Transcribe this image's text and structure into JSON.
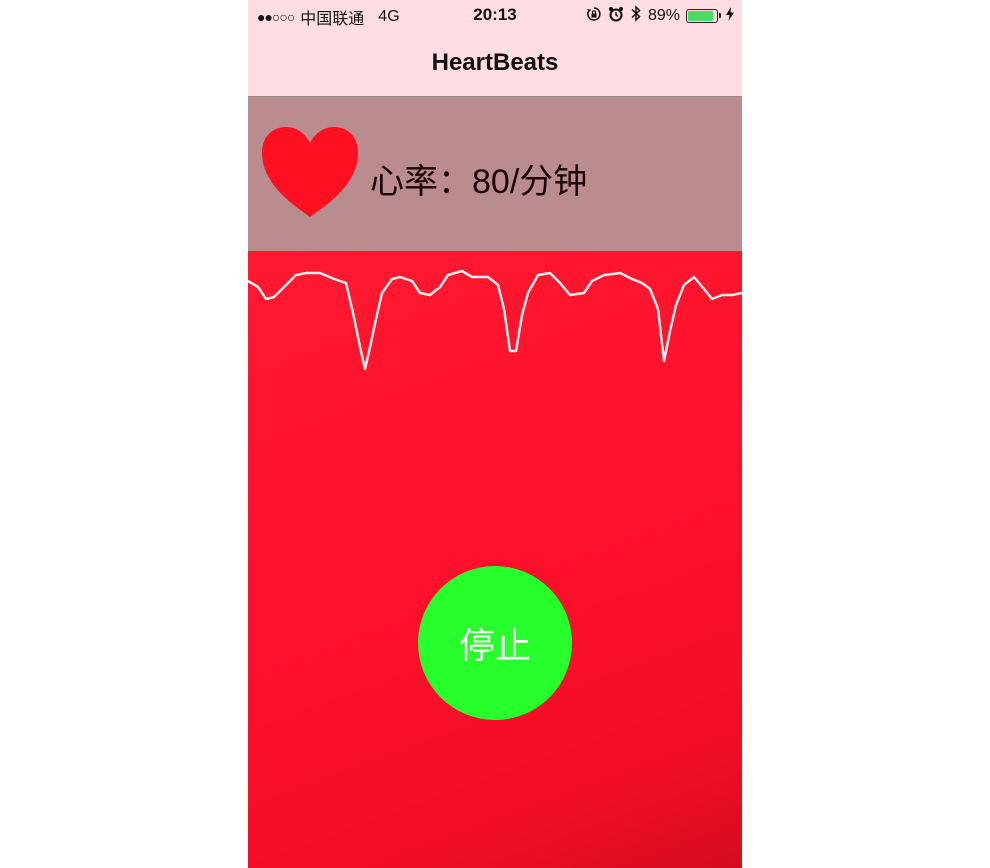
{
  "status_bar": {
    "signal": "●●○○○",
    "carrier": "中国联通",
    "network": "4G",
    "time": "20:13",
    "rotation_lock_icon": "rotation-lock-icon",
    "alarm_icon": "alarm-icon",
    "bluetooth_icon": "bluetooth-icon",
    "battery_percent": "89%",
    "battery_level": 0.89,
    "charging_icon": "charging-bolt-icon"
  },
  "navbar": {
    "title": "HeartBeats"
  },
  "heart_rate": {
    "icon": "heart-icon",
    "label": "心率：80/分钟"
  },
  "actions": {
    "stop_label": "停止"
  },
  "colors": {
    "status_nav_bg": "#ffdde2",
    "panel_bg": "#ba8b8f",
    "heart": "#ff1020",
    "camera_bg": "#ff0f2b",
    "stop_button": "#27ff2d",
    "waveform": "#ffffff"
  }
}
